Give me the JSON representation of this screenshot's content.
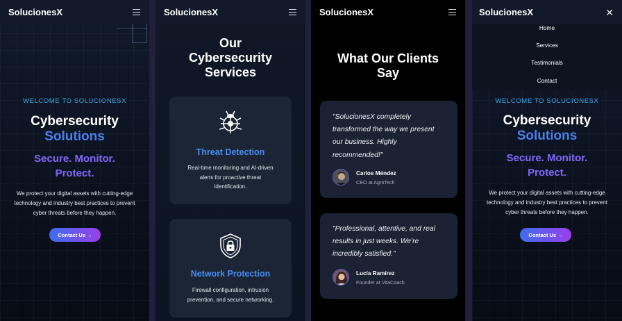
{
  "brand": "SolucionesX",
  "hero": {
    "welcome": "WELCOME TO SOLUCIONESX",
    "title_line1": "Cybersecurity",
    "title_line2": "Solutions",
    "tagline_line1": "Secure. Monitor.",
    "tagline_line2": "Protect.",
    "desc_lines": [
      "We protect your digital assets with cutting-edge",
      "technology and industry best practices to prevent",
      "cyber threats before they happen."
    ],
    "cta": "Contact Us →"
  },
  "services": {
    "title_lines": [
      "Our",
      "Cybersecurity",
      "Services"
    ],
    "items": [
      {
        "icon": "bug-target-icon",
        "title": "Threat Detection",
        "desc_lines": [
          "Real-time monitoring and AI-driven",
          "alerts for proactive threat",
          "identification."
        ]
      },
      {
        "icon": "shield-lock-icon",
        "title": "Network Protection",
        "desc_lines": [
          "Firewall configuration, intrusion",
          "prevention, and secure networking."
        ]
      }
    ]
  },
  "testimonials": {
    "title_lines": [
      "What Our Clients",
      "Say"
    ],
    "items": [
      {
        "quote_lines": [
          "\"SolucionesX completely",
          "transformed the way we present",
          "our business. Highly",
          "recommended!\""
        ],
        "name": "Carlos Méndez",
        "role": "CEO at AgroTech"
      },
      {
        "quote_lines": [
          "\"Professional, attentive, and real",
          "results in just weeks. We're",
          "incredibly satisfied.\""
        ],
        "name": "Lucía Ramírez",
        "role": "Founder at VitaCoach"
      }
    ]
  },
  "menu": {
    "items": [
      "Home",
      "Services",
      "Testimonials",
      "Contact"
    ]
  },
  "colors": {
    "accent_blue": "#4a7ff0",
    "welcome_cyan": "#3ea6e8",
    "tagline_purple": "#7b63ec",
    "card_bg": "#1b2536"
  }
}
